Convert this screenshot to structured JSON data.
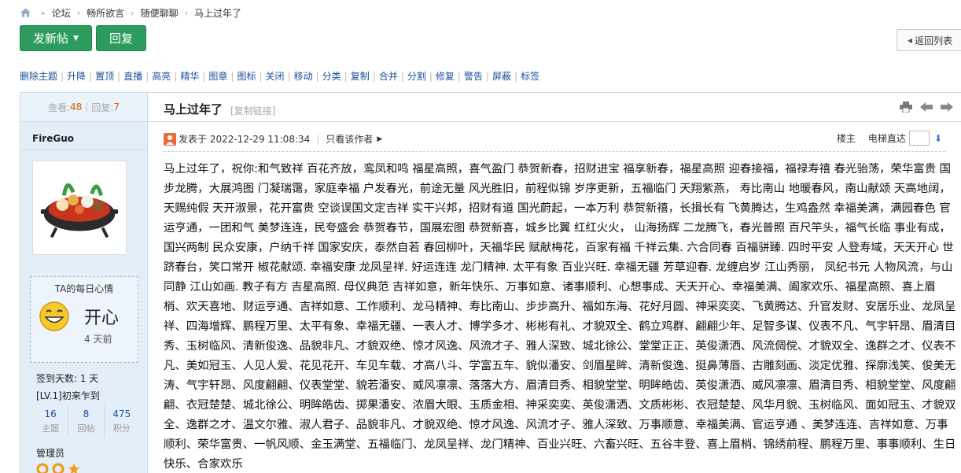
{
  "breadcrumb": [
    "论坛",
    "畅所欲言",
    "随便聊聊",
    "马上过年了"
  ],
  "actions": {
    "new_post": "发新帖",
    "reply": "回复",
    "back_to_list": "返回列表"
  },
  "mod_tools": [
    "删除主题",
    "升降",
    "置顶",
    "直播",
    "高亮",
    "精华",
    "图章",
    "图标",
    "关闭",
    "移动",
    "分类",
    "复制",
    "合并",
    "分割",
    "修复",
    "警告",
    "屏蔽",
    "标签"
  ],
  "stats": {
    "views_label": "查看:",
    "views": "48",
    "replies_label": "回复:",
    "replies": "7"
  },
  "author": {
    "name": "FireGuo",
    "mood_title": "TA的每日心情",
    "mood": "开心",
    "mood_age": "4 天前",
    "signin_days": "签到天数: 1 天",
    "level": "[LV.1]初来乍到",
    "counts": [
      {
        "value": "16",
        "label": "主题"
      },
      {
        "value": "8",
        "label": "回帖"
      },
      {
        "value": "475",
        "label": "积分"
      }
    ],
    "role": "管理员"
  },
  "post": {
    "title": "马上过年了",
    "copy_link": "[复制链接]",
    "posted": "发表于 2022-12-29 11:08:34",
    "only_author": "只看该作者",
    "floor_label": "楼主",
    "elevator_label": "电梯直达",
    "body": "马上过年了，祝你:和气致祥 百花齐放，鸾凤和鸣 福星高照，喜气盈门 恭贺新春，招财进宝 福享新春，福星高照 迎春接福，福禄寿禧 春光骀荡，荣华富贵 国步龙腾，大展鸿图 门凝瑞霭，家庭幸福 户发春光，前途无量 风光胜旧，前程似锦 岁序更新，五福临门 天翔紫燕， 寿比南山 地暖春风，南山献颂 天高地阔， 天赐纯假 天开淑景，花开富贵 空谈误国文定吉祥 实干兴邦，招财有道 国光蔚起，一本万利 恭贺新禧，长揖长有 飞黄腾达，生鸡盎然 幸福美满，满园春色 官运亨通，一团和气 美梦连连，民夸盛会 恭贺春节，国展宏图 恭贺新喜，城乡比翼 红红火火， 山海扬辉 二龙腾飞，春光普照 百尺竿头，福气长临 事业有成，国兴两制 民众安康，户纳千祥 国家安庆，泰然自若 春回柳叶，天福华民 赋献梅花，百家有福 千祥云集. 六合同春 百福骈臻. 四时平安 人登寿域，天天开心 世跻春台，笑口常开 椒花献颂. 幸福安康 龙凤呈祥. 好运连连 龙门精神. 太平有象 百业兴旺. 幸福无疆 芳草迎春. 龙缠启岁 江山秀丽， 凤纪书元 人物风流，与山同静 江山如画. 教子有方 吉星高照. 母仪典范 吉祥如意，新年快乐、万事如意、诸事顺利、心想事成、天天开心、幸福美满、阖家欢乐、福星高照、喜上眉梢、欢天喜地、财运亨通、吉祥如意、工作顺利、龙马精神、寿比南山、步步高升、福如东海、花好月圆、神采奕奕、飞黄腾达、升官发财、安居乐业、龙凤呈祥、四海增辉、鹏程万里、太平有象、幸福无疆、一表人才、博学多才、彬彬有礼、才貌双全、鹤立鸡群、翩翩少年、足智多谋、仪表不凡、气宇轩昂、眉清目秀、玉树临风、清新俊逸、品貌非凡、才貌双绝、惊才风逸、风流才子、雅人深致、城北徐公、堂堂正正、英俊潇洒、风流倜傥、才貌双全、逸群之才、仪表不凡、美如冠玉、人见人爱、花见花开、车见车载、才高八斗、学富五车、貌似潘安、剑眉星眸、清新俊逸、挺鼻薄唇、古雕刻画、淡定优雅、探廓浅笑、俊美无涛、气宇轩昂、风度翩翩、仪表堂堂、貌若潘安、威风凛凛、落落大方、眉清目秀、相貌堂堂、明眸皓齿、英俊潇洒、威风凛凛、眉清目秀、相貌堂堂、风度翩翩、衣冠楚楚、城北徐公、明眸皓齿、掷果潘安、浓眉大眼、玉质金相、神采奕奕、英俊潇洒、文质彬彬、衣冠楚楚、风华月貌、玉树临风、面如冠玉、才貌双全、逸群之才、温文尔雅、淑人君子、品貌非凡、才貌双绝、惊才风逸、风流才子、雅人深致、万事顺意、幸福美满、官运亨通 、美梦连连、吉祥如意、万事顺利、荣华富贵、一帆风顺、金玉满堂、五福临门、龙凤呈祥、龙门精神、百业兴旺、六畜兴旺、五谷丰登、喜上眉梢、锦绣前程、鹏程万里、事事顺利、生日快乐、合家欢乐"
  }
}
